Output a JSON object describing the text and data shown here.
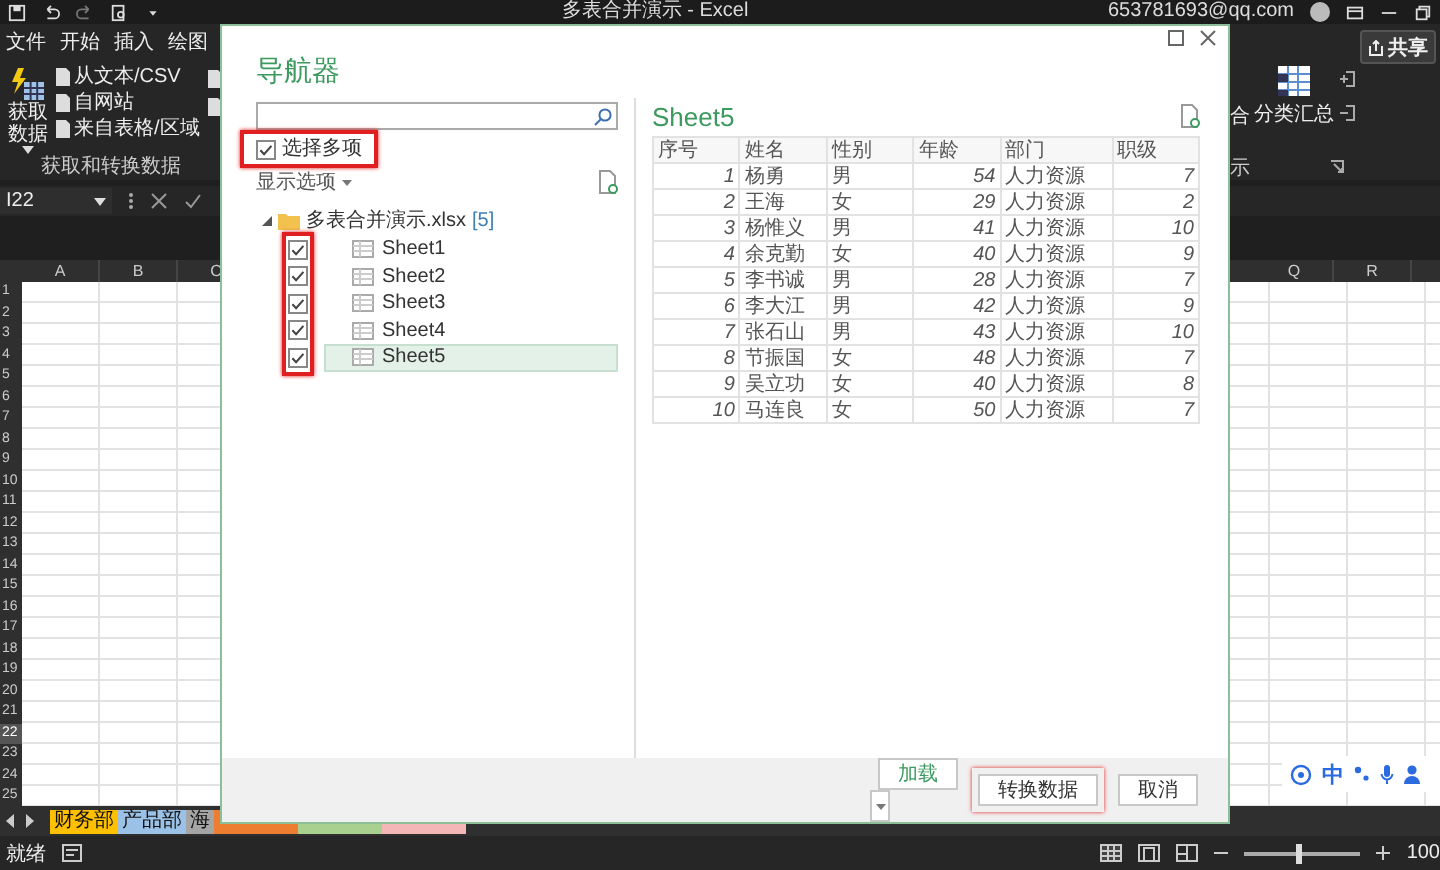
{
  "excel": {
    "title": "多表合并演示 - Excel",
    "account": "653781693@qq.com",
    "ribbon_tabs": [
      "文件",
      "开始",
      "插入",
      "绘图"
    ],
    "get_data": "获取数据",
    "data_sources": [
      "从文本/CSV",
      "自网站",
      "来自表格/区域"
    ],
    "group_label": "获取和转换数据",
    "right_ribbon": {
      "cut_label": "合",
      "subtotal": "分类汇总",
      "group_label": "示"
    },
    "share": "共享",
    "name_box": "I22",
    "columns_left": [
      "A",
      "B",
      "C"
    ],
    "columns_right": [
      "Q",
      "R"
    ],
    "rows": [
      {
        "label": "1",
        "selected": false
      },
      {
        "label": "2",
        "selected": false
      },
      {
        "label": "3",
        "selected": false
      },
      {
        "label": "4",
        "selected": false
      },
      {
        "label": "5",
        "selected": false
      },
      {
        "label": "6",
        "selected": false
      },
      {
        "label": "7",
        "selected": false
      },
      {
        "label": "8",
        "selected": false
      },
      {
        "label": "9",
        "selected": false
      },
      {
        "label": "10",
        "selected": false
      },
      {
        "label": "11",
        "selected": false
      },
      {
        "label": "12",
        "selected": false
      },
      {
        "label": "13",
        "selected": false
      },
      {
        "label": "14",
        "selected": false
      },
      {
        "label": "15",
        "selected": false
      },
      {
        "label": "16",
        "selected": false
      },
      {
        "label": "17",
        "selected": false
      },
      {
        "label": "18",
        "selected": false
      },
      {
        "label": "19",
        "selected": false
      },
      {
        "label": "20",
        "selected": false
      },
      {
        "label": "21",
        "selected": false
      },
      {
        "label": "22",
        "selected": true
      },
      {
        "label": "23",
        "selected": false
      },
      {
        "label": "24",
        "selected": false
      },
      {
        "label": "25",
        "selected": false
      }
    ],
    "sheet_tabs": [
      {
        "label": "财务部",
        "color": "#ffc000"
      },
      {
        "label": "产品部",
        "color": "#9bc2e6"
      },
      {
        "label": "海",
        "color": "#a5a5a5"
      },
      {
        "color": "#ed7d31"
      },
      {
        "color": "#a9d08e"
      },
      {
        "color": "#f4b6b6"
      }
    ],
    "status": "就绪",
    "zoom": {
      "level": 0.45,
      "reading": "100"
    },
    "ime": {
      "label": "中"
    }
  },
  "navigator": {
    "title": "导航器",
    "multi_select": {
      "label": "选择多项",
      "checked": true,
      "highlighted": true
    },
    "display_options": "显示选项",
    "tree": [
      {
        "label": "多表合并演示.xlsx",
        "count": "[5]",
        "expanded": true,
        "checkboxes_highlighted": true,
        "children": [
          {
            "label": "Sheet1",
            "checked": true,
            "selected": false
          },
          {
            "label": "Sheet2",
            "checked": true,
            "selected": false
          },
          {
            "label": "Sheet3",
            "checked": true,
            "selected": false
          },
          {
            "label": "Sheet4",
            "checked": true,
            "selected": false
          },
          {
            "label": "Sheet5",
            "checked": true,
            "selected": true
          }
        ]
      }
    ],
    "preview": {
      "title": "Sheet5",
      "columns": [
        {
          "label": "序号",
          "kind": "number"
        },
        {
          "label": "姓名",
          "kind": "text"
        },
        {
          "label": "性别",
          "kind": "text"
        },
        {
          "label": "年龄",
          "kind": "number"
        },
        {
          "label": "部门",
          "kind": "text"
        },
        {
          "label": "职级",
          "kind": "number"
        }
      ],
      "rows": [
        [
          "1",
          "杨勇",
          "男",
          "54",
          "人力资源",
          "7"
        ],
        [
          "2",
          "王海",
          "女",
          "29",
          "人力资源",
          "2"
        ],
        [
          "3",
          "杨惟义",
          "男",
          "41",
          "人力资源",
          "10"
        ],
        [
          "4",
          "余克勤",
          "女",
          "40",
          "人力资源",
          "9"
        ],
        [
          "5",
          "李书诚",
          "男",
          "28",
          "人力资源",
          "7"
        ],
        [
          "6",
          "李大江",
          "男",
          "42",
          "人力资源",
          "9"
        ],
        [
          "7",
          "张石山",
          "男",
          "43",
          "人力资源",
          "10"
        ],
        [
          "8",
          "节振国",
          "女",
          "48",
          "人力资源",
          "7"
        ],
        [
          "9",
          "吴立功",
          "女",
          "40",
          "人力资源",
          "8"
        ],
        [
          "10",
          "马连良",
          "女",
          "50",
          "人力资源",
          "7"
        ]
      ]
    },
    "buttons": [
      {
        "label": "加载",
        "kind": "split",
        "highlighted": false
      },
      {
        "label": "转换数据",
        "kind": "plain",
        "highlighted": true
      },
      {
        "label": "取消",
        "kind": "plain",
        "highlighted": false
      }
    ]
  }
}
